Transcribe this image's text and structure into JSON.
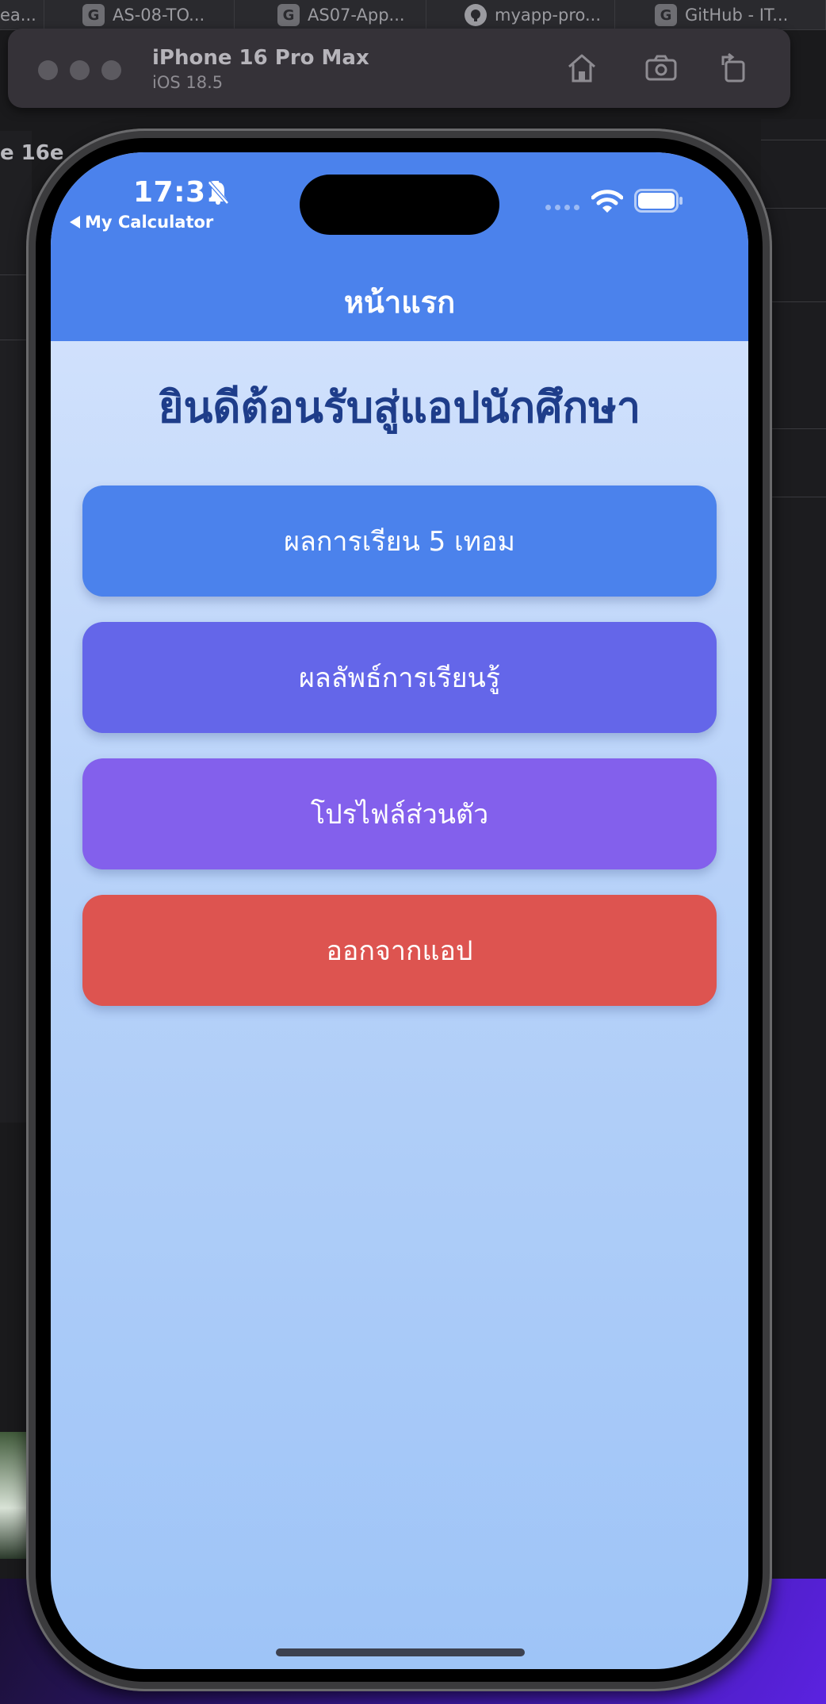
{
  "browser_tabs": [
    {
      "favicon": "G",
      "label": "ea..."
    },
    {
      "favicon": "G",
      "label": "AS-08-TO..."
    },
    {
      "favicon": "G",
      "label": "AS07-App..."
    },
    {
      "favicon": "github-icon",
      "label": "myapp-pro..."
    },
    {
      "favicon": "G",
      "label": "GitHub - IT..."
    }
  ],
  "simulator": {
    "device_name": "iPhone 16 Pro Max",
    "os_version": "iOS 18.5",
    "toolbar_icons": [
      "home-icon",
      "screenshot-icon",
      "rotate-icon"
    ]
  },
  "background": {
    "left_label": "e 16e"
  },
  "status_bar": {
    "time": "17:31",
    "back_app": "My Calculator",
    "icons": [
      "bell-slash-icon",
      "signal-icon",
      "wifi-icon",
      "battery-icon"
    ]
  },
  "nav": {
    "title": "หน้าแรก"
  },
  "main": {
    "welcome": "ยินดีต้อนรับสู่แอปนักศึกษา",
    "buttons": [
      {
        "label": "ผลการเรียน 5 เทอม",
        "color": "#4b82ec"
      },
      {
        "label": "ผลลัพธ์การเรียนรู้",
        "color": "#6466e9"
      },
      {
        "label": "โปรไฟล์ส่วนตัว",
        "color": "#8360ec"
      },
      {
        "label": "ออกจากแอป",
        "color": "#dd5450"
      }
    ]
  },
  "colors": {
    "nav_bar": "#4b82ec",
    "welcome_text": "#1e3d8a",
    "background_top": "#d9e6fd",
    "background_bottom": "#9ec4f7"
  }
}
